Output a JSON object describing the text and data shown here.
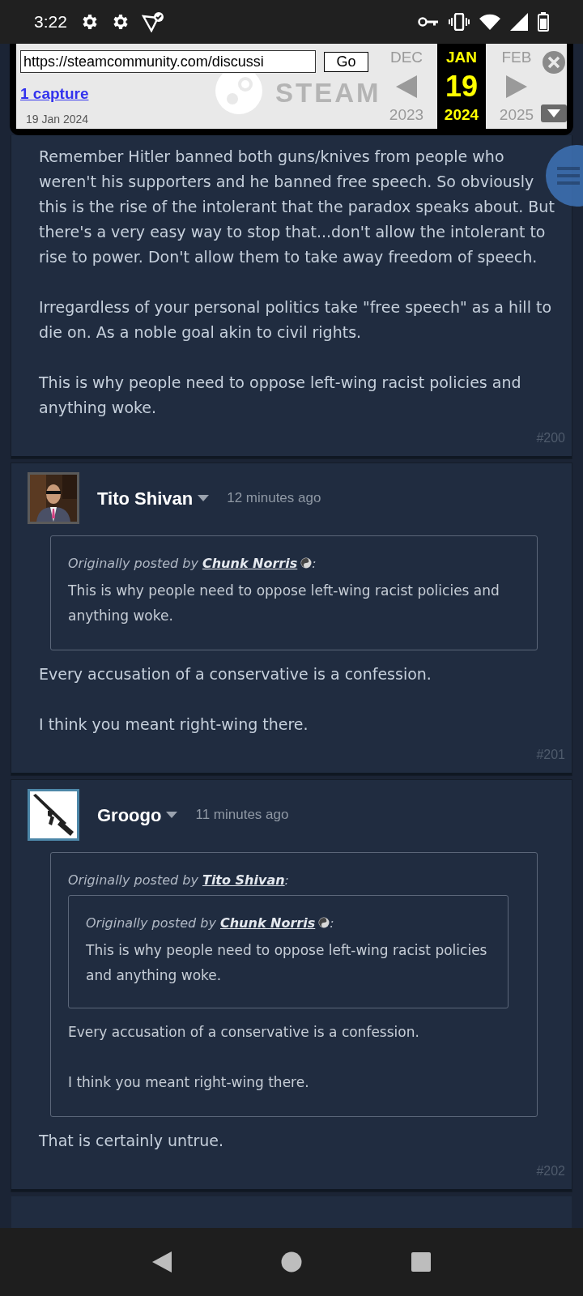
{
  "status_bar": {
    "time": "3:22"
  },
  "wayback": {
    "url": "https://steamcommunity.com/discussi",
    "go_button": "Go",
    "captures": "1 capture",
    "capture_date": "19 Jan 2024",
    "logo_text": "STEAM",
    "months": [
      {
        "month": "DEC",
        "year": "2023",
        "selected": false
      },
      {
        "month": "JAN",
        "day": "19",
        "year": "2024",
        "selected": true
      },
      {
        "month": "FEB",
        "year": "2025",
        "selected": false
      }
    ]
  },
  "posts": [
    {
      "paragraphs": [
        "Remember Hitler banned both guns/knives from people who weren't his supporters and he banned free speech. So obviously this is the rise of the intolerant that the paradox speaks about. But there's a very easy way to stop that...don't allow the intolerant to rise to power. Don't allow them to take away freedom of speech.",
        "Irregardless of your personal politics take \"free speech\" as a hill to die on. As a noble goal akin to civil rights.",
        "This is why people need to oppose left-wing racist policies and anything woke."
      ],
      "number": "#200"
    },
    {
      "author": "Tito Shivan",
      "time": "12 minutes ago",
      "avatar": {
        "kind": "person"
      },
      "quote": {
        "prefix": "Originally posted by",
        "author": "Chunk Norris",
        "author_emoticon": true,
        "colon": ":",
        "paragraphs": [
          "This is why people need to oppose left-wing racist policies and anything woke."
        ]
      },
      "paragraphs": [
        "Every accusation of a conservative is a confession.",
        "I think you meant right-wing there."
      ],
      "number": "#201"
    },
    {
      "author": "Groogo",
      "time": "11 minutes ago",
      "avatar": {
        "kind": "rifle"
      },
      "quote": {
        "prefix": "Originally posted by",
        "author": "Tito Shivan",
        "author_emoticon": false,
        "colon": ":",
        "quote": {
          "prefix": "Originally posted by",
          "author": "Chunk Norris",
          "author_emoticon": true,
          "colon": ":",
          "paragraphs": [
            "This is why people need to oppose left-wing racist policies and anything woke."
          ]
        },
        "paragraphs": [
          "Every accusation of a conservative is a confession.",
          "I think you meant right-wing there."
        ]
      },
      "paragraphs": [
        "That is certainly untrue."
      ],
      "number": "#202"
    }
  ]
}
